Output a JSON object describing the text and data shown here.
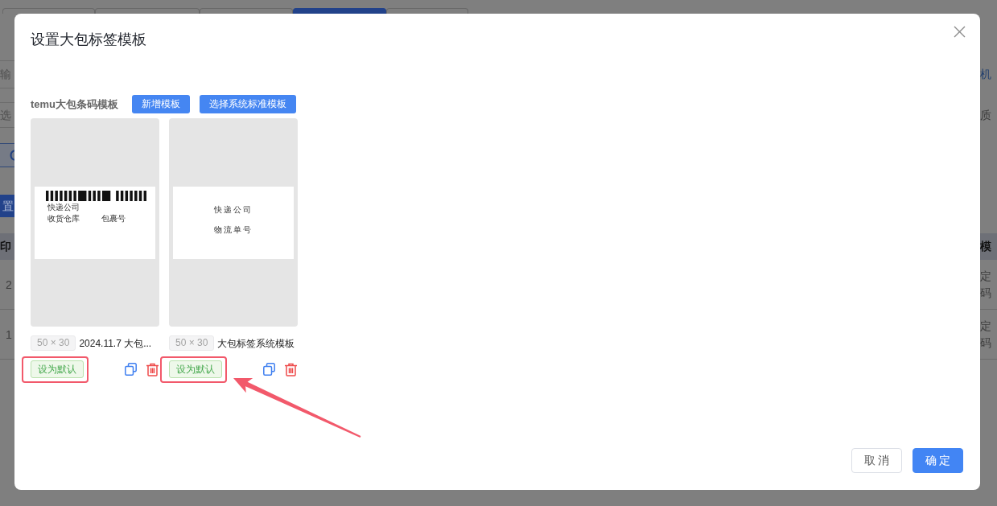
{
  "background": {
    "tabs": [
      {
        "selected": false
      },
      {
        "selected": false
      },
      {
        "selected": false
      },
      {
        "selected": true
      },
      {
        "selected": false
      }
    ],
    "left_edge": {
      "input_text": "输",
      "select_text": "选",
      "button_text": "置",
      "table_header": "印",
      "rows": [
        "2",
        "1"
      ]
    },
    "right_edge": {
      "link_text": "机",
      "label_text": "质",
      "table_header": "模",
      "rows": [
        [
          "定",
          "码"
        ],
        [
          "定",
          "码"
        ]
      ]
    }
  },
  "dialog": {
    "title": "设置大包标签模板",
    "section": {
      "label": "temu大包条码模板",
      "buttons": [
        {
          "label": "新增模板"
        },
        {
          "label": "选择系统标准模板"
        }
      ]
    },
    "templates": [
      {
        "size": "50 × 30",
        "name": "2024.11.7 大包...",
        "preview": {
          "kind": "barcode",
          "lines": [
            "快递公司"
          ],
          "fields": [
            "收货仓库",
            "包裹号"
          ]
        },
        "default_button": {
          "label": "设为默认",
          "annotation_box": true,
          "annotation_arrow": false
        }
      },
      {
        "size": "50 × 30",
        "name": "大包标签系统模板",
        "preview": {
          "kind": "text",
          "lines": [
            "快递公司",
            "物流单号"
          ]
        },
        "default_button": {
          "label": "设为默认",
          "annotation_box": true,
          "annotation_arrow": true
        }
      }
    ],
    "footer_buttons": [
      {
        "label": "取 消",
        "kind": "secondary"
      },
      {
        "label": "确 定",
        "kind": "primary"
      }
    ]
  }
}
